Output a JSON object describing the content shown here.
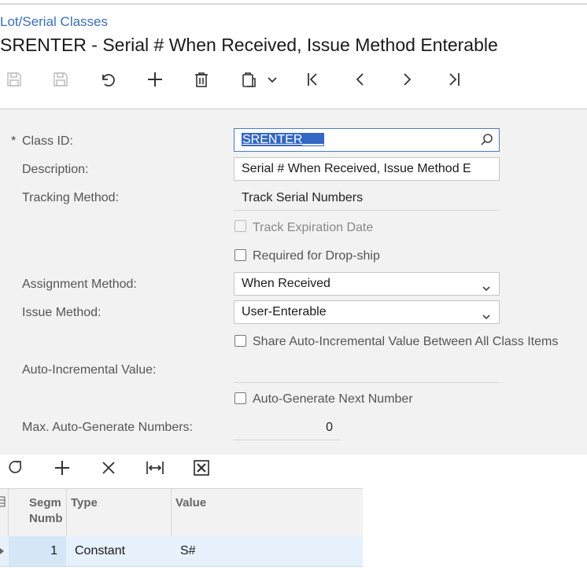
{
  "breadcrumb": "Lot/Serial Classes",
  "title": "SRENTER - Serial # When Received, Issue Method Enterable",
  "toolbar": {
    "icons": [
      "save-close-icon",
      "save-icon",
      "undo-icon",
      "add-icon",
      "delete-icon",
      "clipboard-icon",
      "chevron-down-icon",
      "first-icon",
      "previous-icon",
      "next-icon",
      "last-icon"
    ]
  },
  "form": {
    "required_mark": "*",
    "class_id_label": "Class ID:",
    "class_id_value": "SRENTER___",
    "description_label": "Description:",
    "description_value": "Serial # When Received, Issue Method E",
    "tracking_label": "Tracking Method:",
    "tracking_value": "Track Serial Numbers",
    "track_expiration_label": "Track Expiration Date",
    "required_dropship_label": "Required for Drop-ship",
    "assignment_label": "Assignment Method:",
    "assignment_value": "When Received",
    "issue_label": "Issue Method:",
    "issue_value": "User-Enterable",
    "share_auto_label": "Share Auto-Incremental Value Between All Class Items",
    "auto_incremental_label": "Auto-Incremental Value:",
    "auto_incremental_value": "",
    "auto_generate_label": "Auto-Generate Next Number",
    "max_auto_label": "Max. Auto-Generate Numbers:",
    "max_auto_value": "0"
  },
  "grid_toolbar": {
    "icons": [
      "refresh-icon",
      "add-row-icon",
      "delete-row-icon",
      "fit-columns-icon",
      "export-excel-icon"
    ]
  },
  "grid": {
    "columns": [
      "Segm Numb",
      "Type",
      "Value"
    ],
    "rows": [
      {
        "segment": "1",
        "type": "Constant",
        "value": "S#"
      }
    ]
  },
  "colors": {
    "accent": "#3a6fb5",
    "selection": "#3367c4",
    "form_bg": "#f2f2f2",
    "row_bg": "#e7f1fb"
  }
}
